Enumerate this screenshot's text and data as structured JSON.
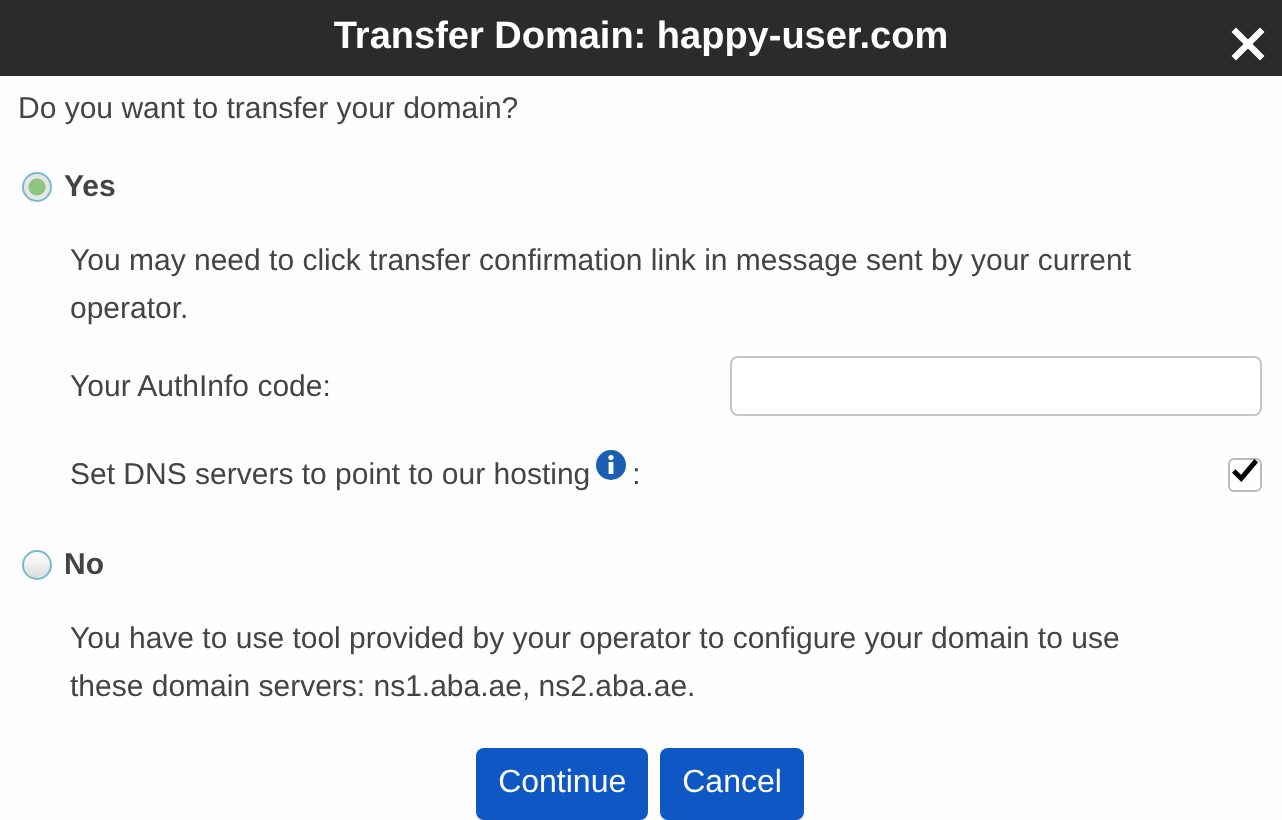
{
  "window": {
    "title": "Transfer Domain: happy-user.com"
  },
  "question": "Do you want to transfer your domain?",
  "options": [
    {
      "label": "Yes",
      "selected": true,
      "description": "You may need to click transfer confirmation link in message sent by your current operator.",
      "fields": [
        {
          "kind": "text",
          "label": "Your AuthInfo code:"
        },
        {
          "kind": "checkbox",
          "label": "Set DNS servers to point to our hosting",
          "info": true,
          "label_end": ":",
          "checked": true
        }
      ]
    },
    {
      "label": "No",
      "selected": false,
      "description": "You have to use tool provided by your operator to configure your domain to use these domain servers: ns1.aba.ae, ns2.aba.ae."
    }
  ],
  "buttons": [
    "Continue",
    "Cancel"
  ]
}
